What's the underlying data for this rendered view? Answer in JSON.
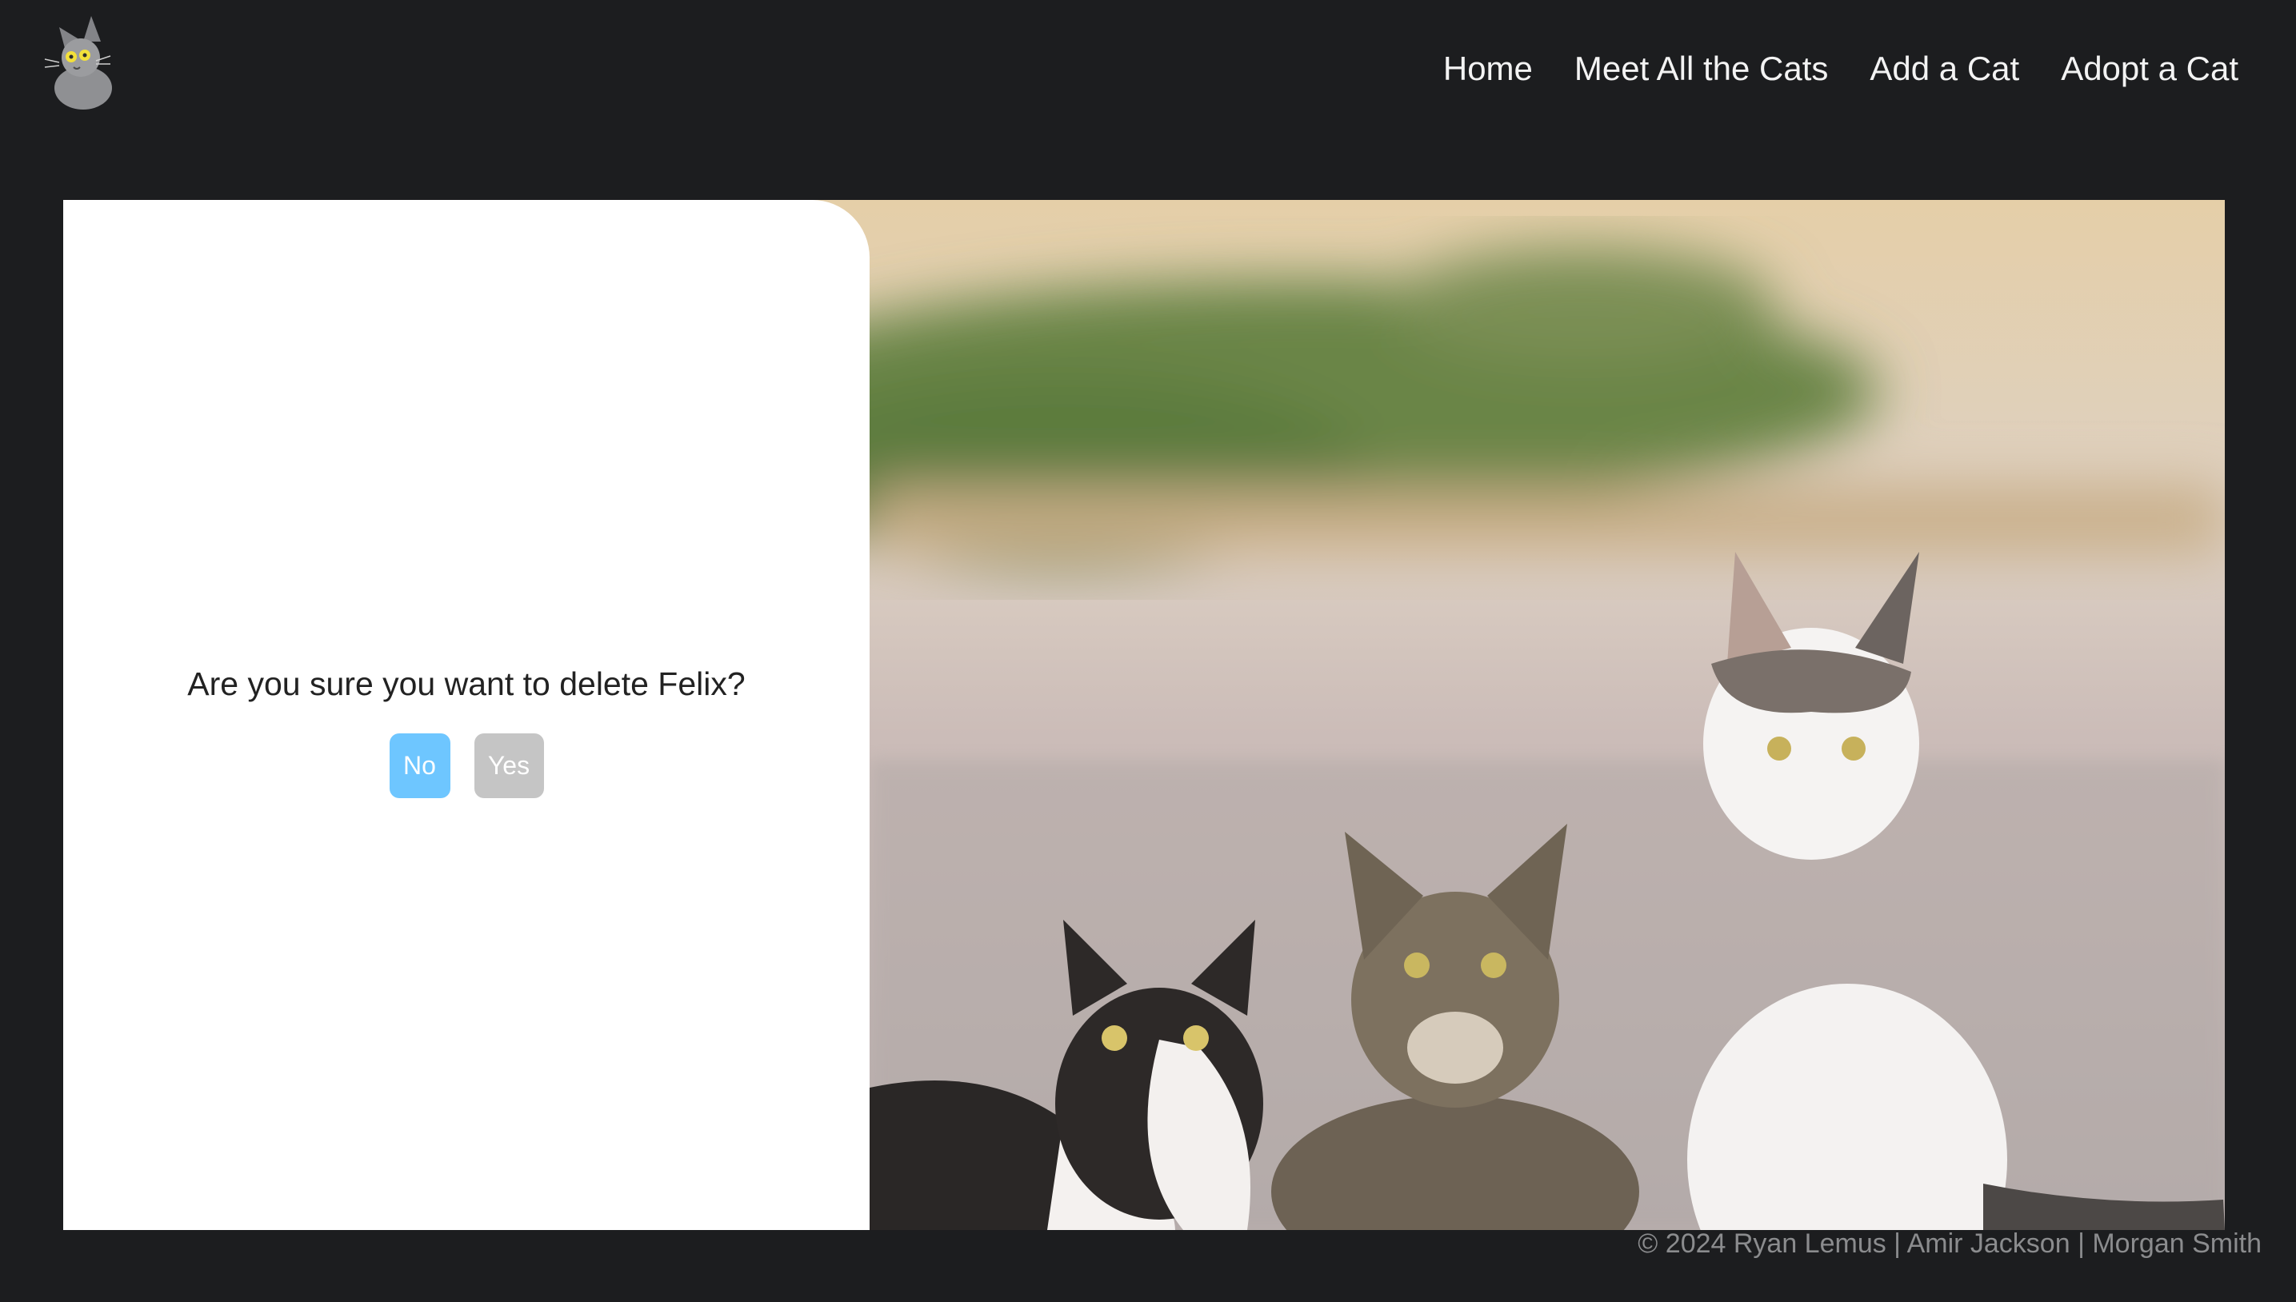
{
  "nav": {
    "logo_icon": "cat-logo-icon",
    "links": [
      {
        "label": "Home"
      },
      {
        "label": "Meet All the Cats"
      },
      {
        "label": "Add a Cat"
      },
      {
        "label": "Adopt a Cat"
      }
    ]
  },
  "dialog": {
    "question": "Are you sure you want to delete Felix?",
    "no_label": "No",
    "yes_label": "Yes"
  },
  "colors": {
    "background": "#1c1d1f",
    "no_button": "#6ec6ff",
    "yes_button": "#c5c5c5",
    "nav_text": "#f3f3f3",
    "footer_text": "#8b8c8e"
  },
  "hero": {
    "image": "three-cats-photo"
  },
  "footer": {
    "text": "© 2024 Ryan Lemus | Amir Jackson | Morgan Smith"
  }
}
